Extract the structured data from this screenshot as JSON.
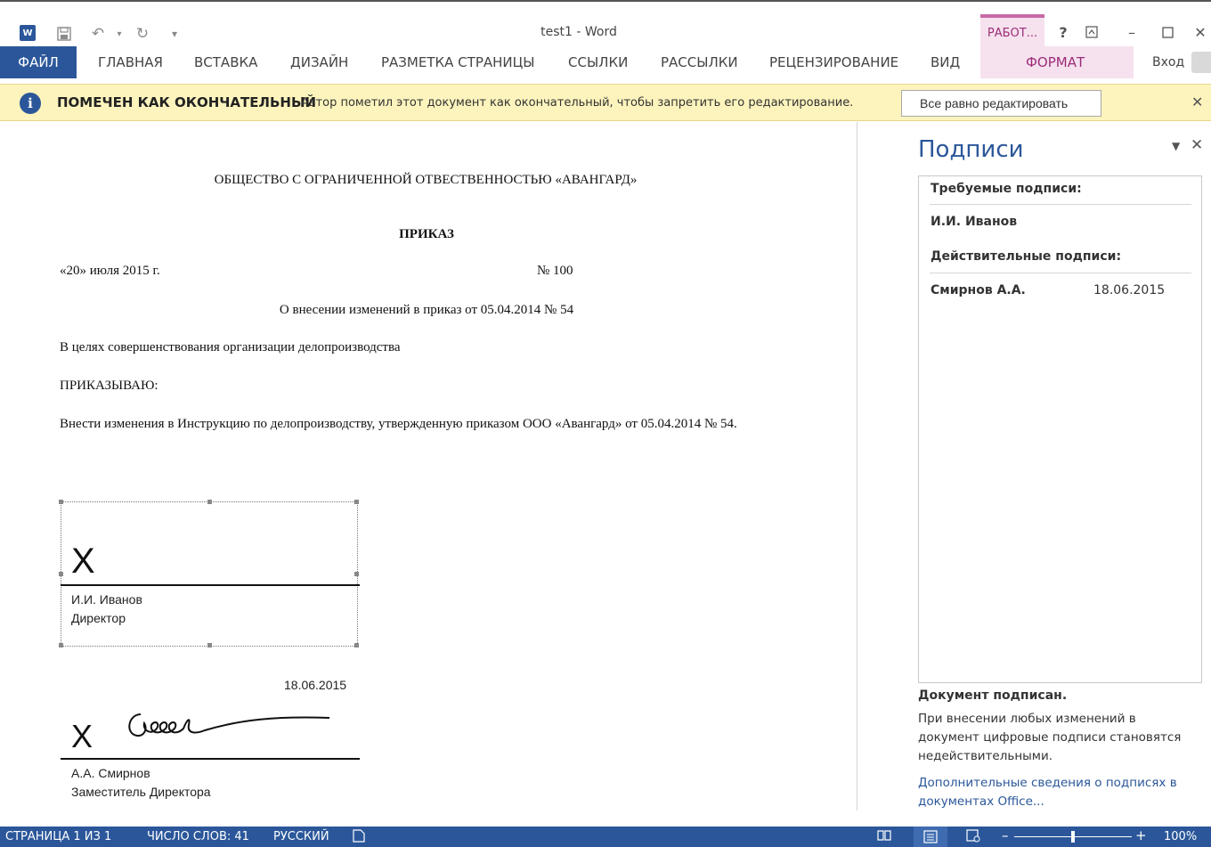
{
  "titlebar": {
    "window_title": "test1 - Word",
    "contextual_tab": "РАБОТ...",
    "help": "?",
    "icons": [
      "word-app-icon",
      "save-icon",
      "undo-icon",
      "redo-icon",
      "customize-qat-icon"
    ]
  },
  "ribbon": {
    "tabs": [
      "ФАЙЛ",
      "ГЛАВНАЯ",
      "ВСТАВКА",
      "ДИЗАЙН",
      "РАЗМЕТКА СТРАНИЦЫ",
      "ССЫЛКИ",
      "РАССЫЛКИ",
      "РЕЦЕНЗИРОВАНИЕ",
      "ВИД",
      "ФОРМАТ"
    ],
    "signin": "Вход"
  },
  "message_bar": {
    "title": "ПОМЕЧЕН КАК ОКОНЧАТЕЛЬНЫЙ",
    "text": "Автор пометил этот документ как окончательный, чтобы запретить его редактирование.",
    "button": "Все равно редактировать"
  },
  "document": {
    "org": "ОБЩЕСТВО С ОГРАНИЧЕННОЙ ОТВЕСТВЕННОСТЬЮ «АВАНГАРД»",
    "heading": "ПРИКАЗ",
    "date": "«20» июля 2015 г.",
    "number": "№ 100",
    "subject": "О внесении изменений в приказ от 05.04.2014 № 54",
    "purpose": "В целях совершенствования организации делопроизводства",
    "order": "ПРИКАЗЫВАЮ:",
    "body": "Внести изменения в Инструкцию по делопроизводству, утвержденную приказом ООО «Авангард» от 05.04.2014 № 54.",
    "signature1": {
      "x": "X",
      "name": "И.И. Иванов",
      "title": "Директор"
    },
    "signature2": {
      "date": "18.06.2015",
      "x": "X",
      "name": "А.А. Смирнов",
      "title": "Заместитель Директора"
    }
  },
  "signatures_pane": {
    "title": "Подписи",
    "required_header": "Требуемые подписи:",
    "required": [
      {
        "name": "И.И. Иванов"
      }
    ],
    "valid_header": "Действительные подписи:",
    "valid": [
      {
        "name": "Смирнов А.А.",
        "date": "18.06.2015"
      }
    ],
    "status_title": "Документ подписан.",
    "status_text": "При внесении любых изменений в документ цифровые подписи становятся недействительными.",
    "link": "Дополнительные сведения о подписях в документах Office..."
  },
  "statusbar": {
    "page": "СТРАНИЦА 1 ИЗ 1",
    "words": "ЧИСЛО СЛОВ: 41",
    "language": "РУССКИЙ",
    "zoom": "100%",
    "zoom_level": 0.5
  },
  "colors": {
    "accent": "#2b579a",
    "contextual": "#c86aa6",
    "message_bar": "#fdf4bd"
  }
}
